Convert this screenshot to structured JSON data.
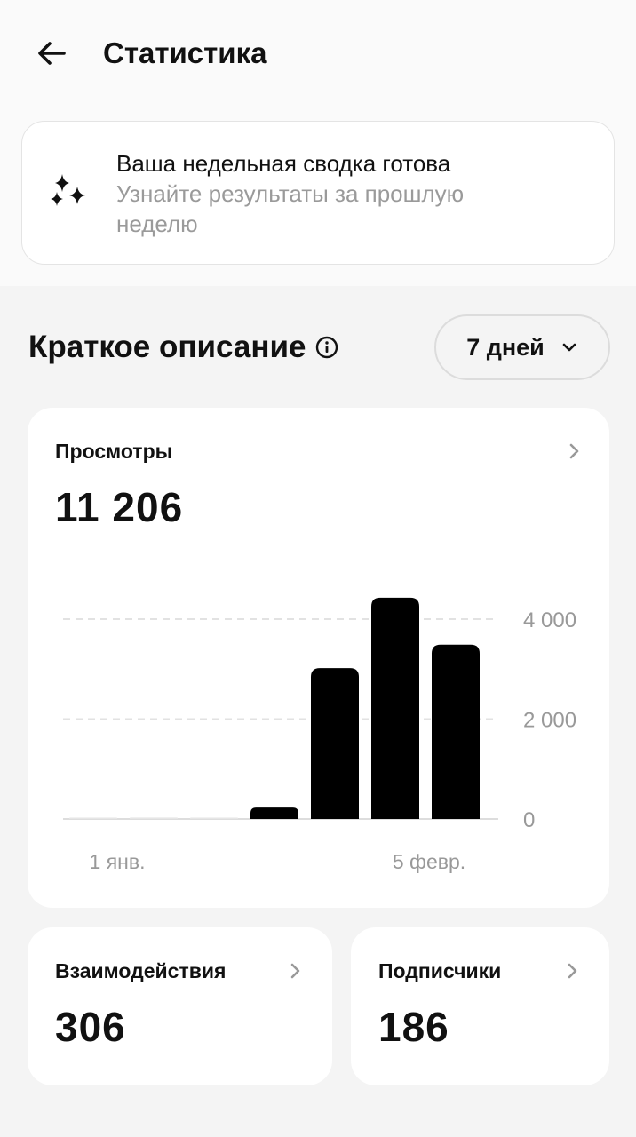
{
  "header": {
    "title": "Статистика",
    "back_icon": "arrow-left-icon"
  },
  "promo": {
    "icon": "sparkles-icon",
    "title": "Ваша недельная сводка готова",
    "subtitle": "Узнайте результаты за прошлую неделю"
  },
  "summary": {
    "title": "Краткое описание",
    "info_icon": "info-icon",
    "period_label": "7 дней"
  },
  "views_card": {
    "label": "Просмотры",
    "value": "11 206"
  },
  "engagement_card": {
    "label": "Взаимодействия",
    "value": "306"
  },
  "followers_card": {
    "label": "Подписчики",
    "value": "186"
  },
  "chart_data": {
    "type": "bar",
    "categories": [
      "1 янв.",
      "",
      "",
      "",
      "",
      "",
      "5 февр."
    ],
    "values": [
      0,
      30,
      0,
      230,
      3020,
      4430,
      3490
    ],
    "x_tick_labels": [
      "1 янв.",
      "5 февр."
    ],
    "y_ticks": [
      0,
      2000,
      4000
    ],
    "y_tick_labels": [
      "0",
      "2 000",
      "4 000"
    ],
    "ylim": [
      0,
      4500
    ],
    "grid": true,
    "colors": {
      "bar": "#000000",
      "grid": "#e2e2e2",
      "axis": "#dddddd",
      "tick": "#999999"
    }
  }
}
